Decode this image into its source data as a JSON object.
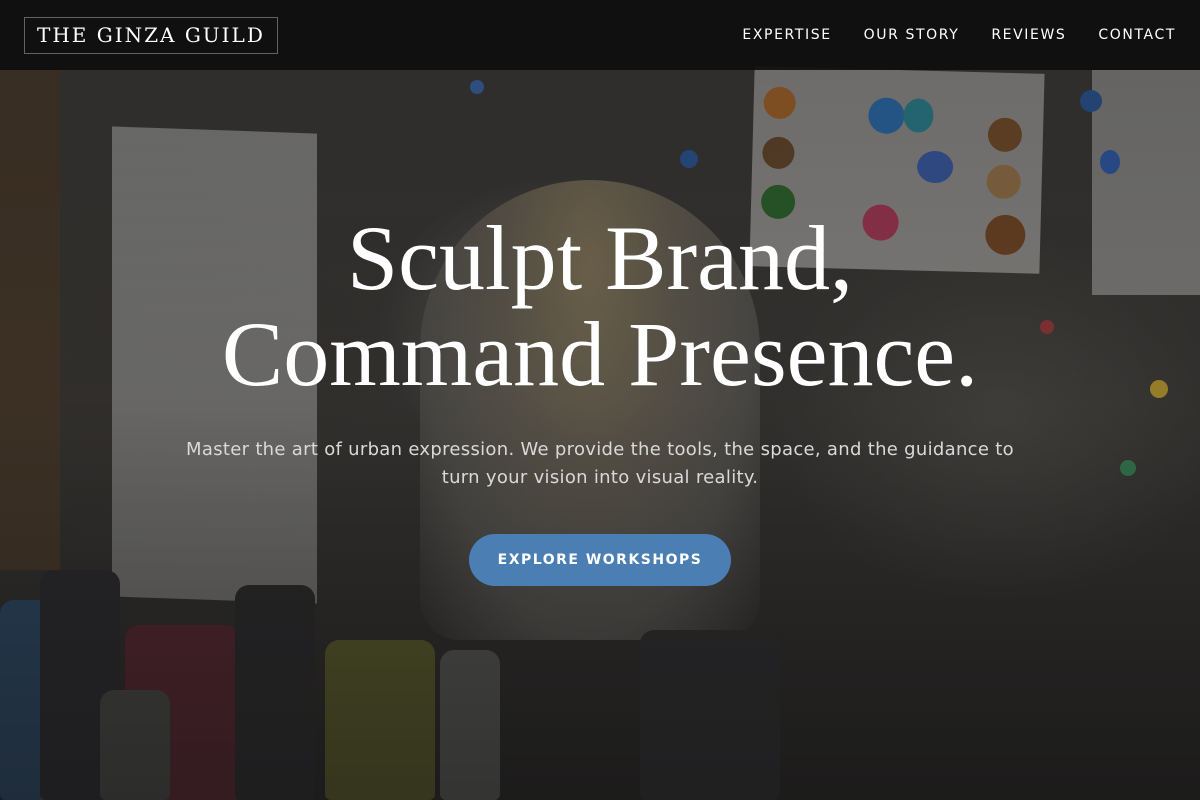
{
  "brand": {
    "logo_text": "THE GINZA GUILD"
  },
  "nav": {
    "links": [
      {
        "label": "EXPERTISE"
      },
      {
        "label": "OUR STORY"
      },
      {
        "label": "REVIEWS"
      },
      {
        "label": "CONTACT"
      }
    ]
  },
  "hero": {
    "title_line1": "Sculpt Brand,",
    "title_line2": "Command Presence.",
    "subtitle": "Master the art of urban expression. We provide the tools, the space, and the guidance to turn your vision into visual reality.",
    "cta_label": "EXPLORE WORKSHOPS"
  },
  "colors": {
    "accent": "#4b7fb3",
    "nav_background": "#0e0e0e",
    "text_primary": "#ffffff",
    "text_secondary": "#d9d9d9"
  }
}
